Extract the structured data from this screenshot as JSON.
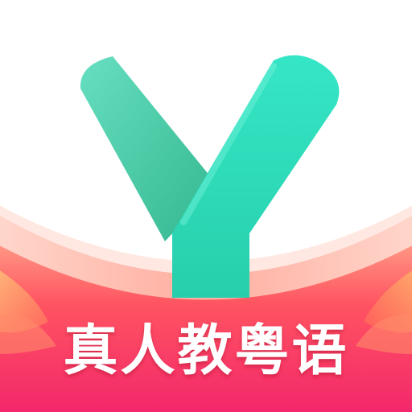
{
  "app_icon": {
    "tagline": "真人教粤语",
    "logo_mark": "letter-y-mark",
    "colors": {
      "logo_light": "#2fe0c0",
      "logo_dark": "#3bbf9c",
      "ribbon_top": "#ff8c7a",
      "ribbon_middle": "#ff4d5e",
      "ribbon_bottom": "#f5266b",
      "ribbon_accent": "#ffb36b",
      "background": "#ffffff"
    }
  }
}
